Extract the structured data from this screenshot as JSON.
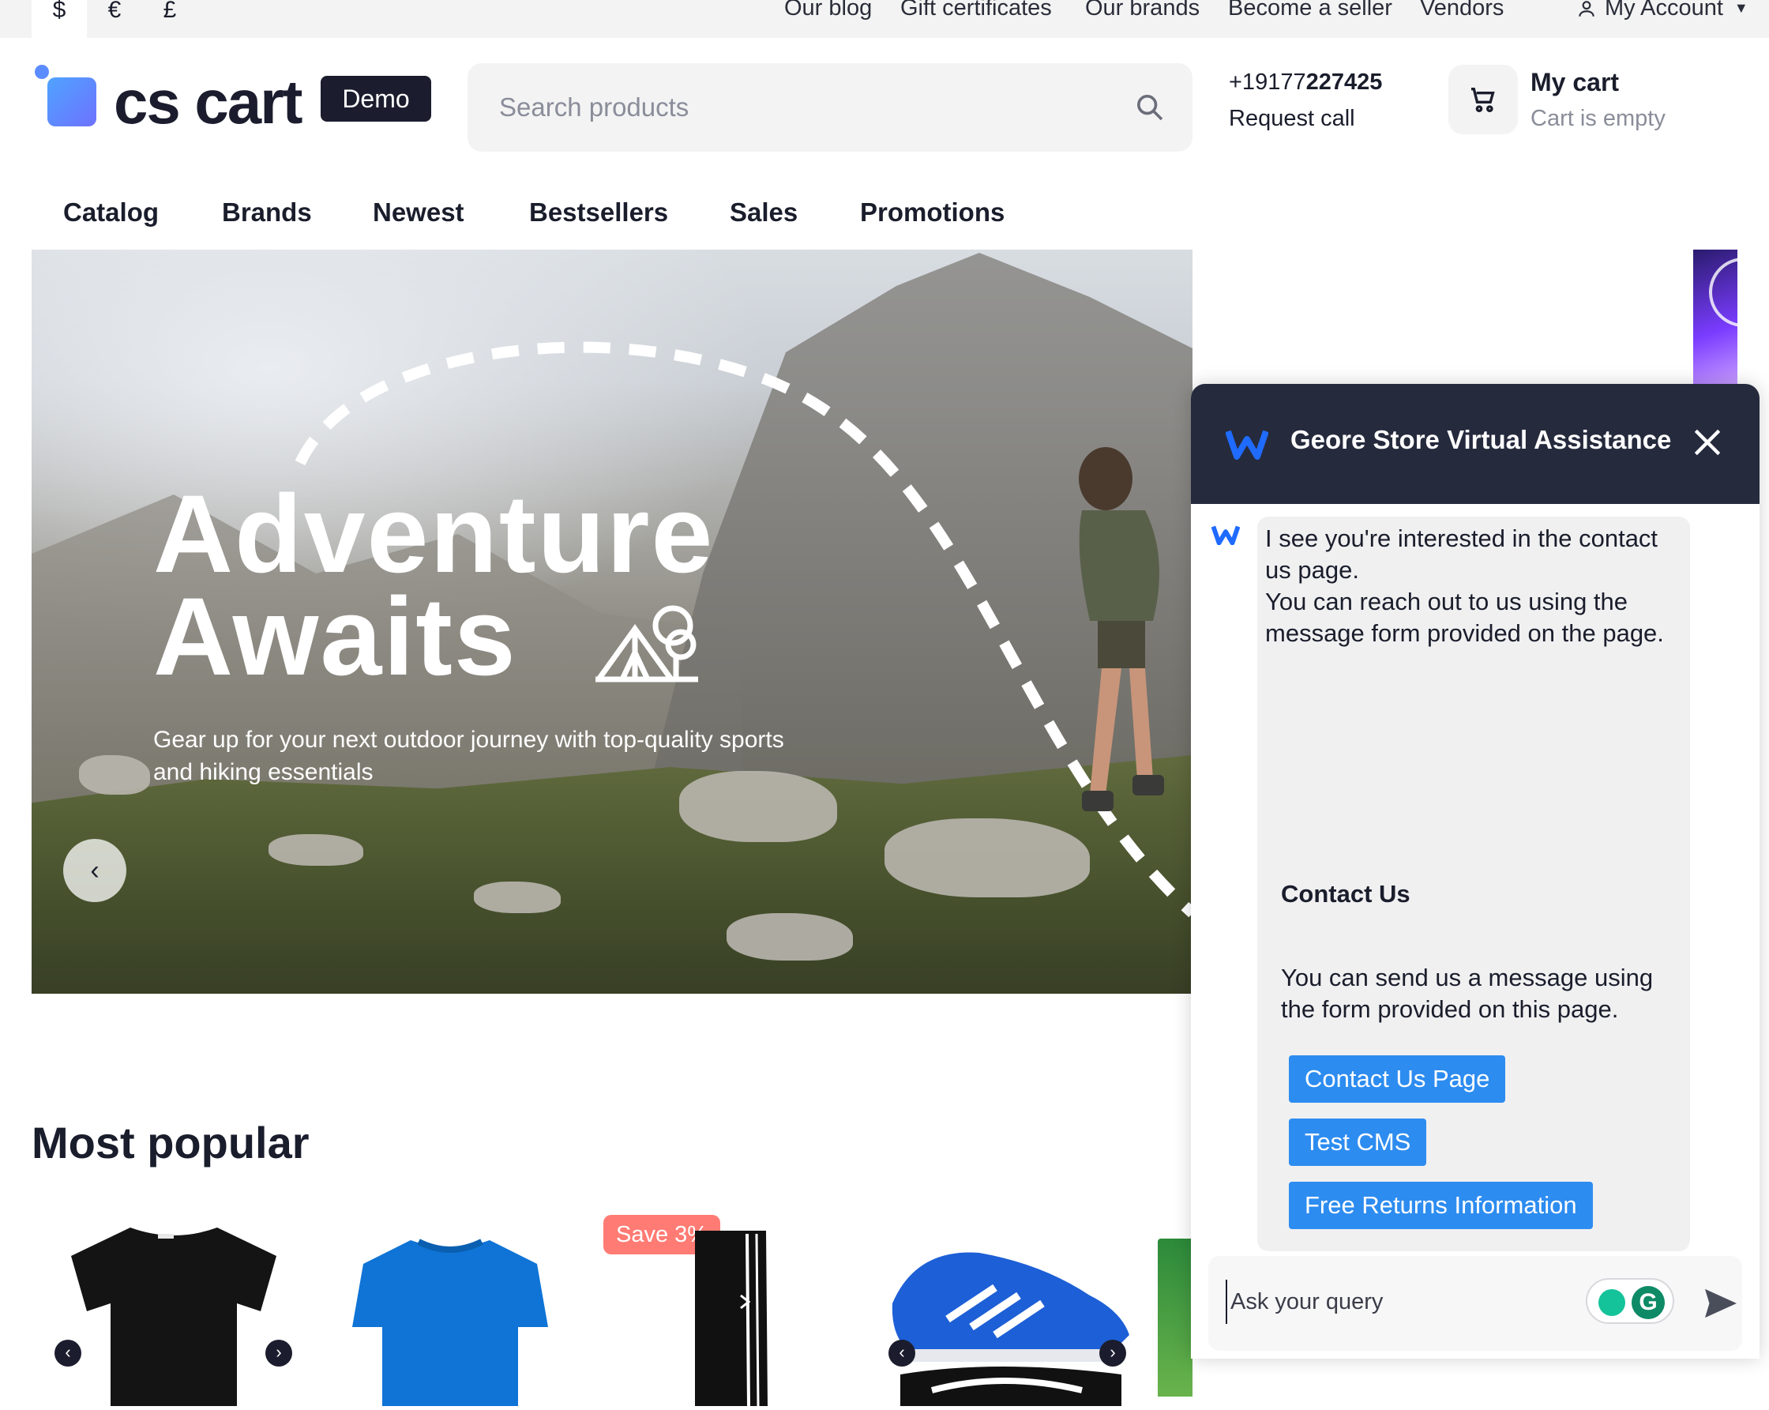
{
  "topbar": {
    "currencies": [
      "$",
      "€",
      "£"
    ],
    "links": [
      "Our blog",
      "Gift certificates",
      "Our brands",
      "Become a seller",
      "Vendors"
    ],
    "account_label": "My Account"
  },
  "header": {
    "logo_text": "cs cart",
    "badge": "Demo",
    "search_placeholder": "Search products",
    "phone_prefix": "+19177",
    "phone_bold": "227425",
    "request_call": "Request call",
    "cart_title": "My cart",
    "cart_status": "Cart is empty"
  },
  "nav": [
    "Catalog",
    "Brands",
    "Newest",
    "Bestsellers",
    "Sales",
    "Promotions"
  ],
  "hero": {
    "title_line1": "Adventure",
    "title_line2": "Awaits",
    "subtitle": "Gear up for your next outdoor journey with top-quality sports and hiking essentials",
    "prev_icon": "chevron-left-icon"
  },
  "popular": {
    "title": "Most popular",
    "badge": "Save 3%"
  },
  "chat": {
    "title": "Geore Store Virtual Assistance",
    "message_line1": "I see you're interested in the contact us page.",
    "message_line2": "You can reach out to us using the message form provided on the page.",
    "heading": "Contact Us",
    "body": "You can send us a message using the form provided on this page.",
    "buttons": [
      "Contact Us Page",
      "Test CMS",
      "Free Returns Information"
    ],
    "input_placeholder": "Ask your query",
    "grammarly_letter": "G"
  },
  "colors": {
    "dark": "#262a3d",
    "accent_blue": "#2d8cf0",
    "sale_badge": "#ff7b73",
    "logo_gradient_start": "#4fa3ff",
    "logo_gradient_end": "#6e72ff"
  }
}
